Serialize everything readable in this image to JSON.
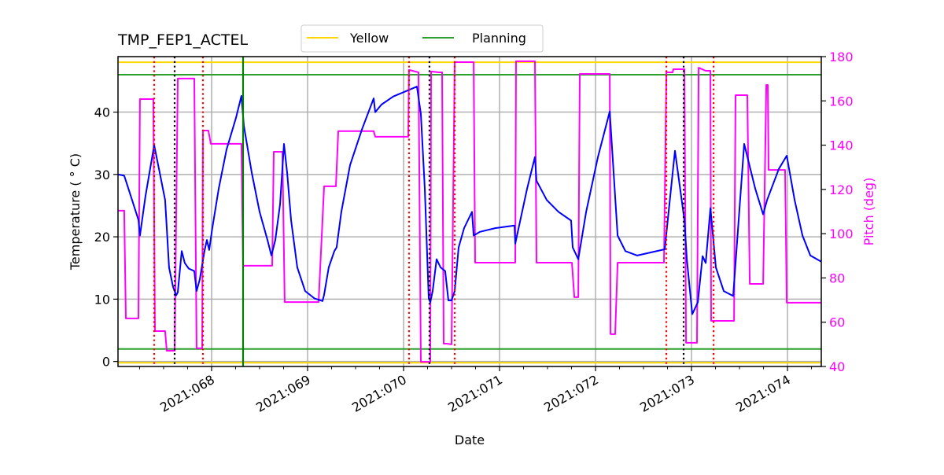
{
  "chart_data": {
    "type": "line",
    "title": "TMP_FEP1_ACTEL",
    "xlabel": "Date",
    "ylabel": "Temperature ($^\\circ$C)",
    "ylabel_display": "Temperature ( ° C)",
    "y2label": "Pitch (deg)",
    "xlim": [
      67.025,
      74.352
    ],
    "ylim": [
      -0.8,
      48.9
    ],
    "y2lim": [
      40,
      180
    ],
    "grid": true,
    "legend_position": "top-center",
    "x_ticks": [
      {
        "value": 68,
        "label": "2021:068"
      },
      {
        "value": 69,
        "label": "2021:069"
      },
      {
        "value": 70,
        "label": "2021:070"
      },
      {
        "value": 71,
        "label": "2021:071"
      },
      {
        "value": 72,
        "label": "2021:072"
      },
      {
        "value": 73,
        "label": "2021:073"
      },
      {
        "value": 74,
        "label": "2021:074"
      }
    ],
    "x_minor_step": 0.25,
    "y_ticks": [
      0,
      10,
      20,
      30,
      40
    ],
    "y2_ticks": [
      40,
      60,
      80,
      100,
      120,
      140,
      160,
      180
    ],
    "legend": [
      {
        "name": "Yellow",
        "color": "#ffd700"
      },
      {
        "name": "Planning",
        "color": "#2ca02c"
      }
    ],
    "limits": {
      "yellow": {
        "color": "#ffd700",
        "values": [
          48.0,
          -0.2
        ]
      },
      "planning": {
        "color": "#2ca02c",
        "values": [
          46.0,
          2.0
        ]
      }
    },
    "vlines": [
      {
        "x": 67.402,
        "color": "#ff0000",
        "style": "dotted"
      },
      {
        "x": 67.615,
        "color": "#000000",
        "style": "dotted"
      },
      {
        "x": 67.91,
        "color": "#ff0000",
        "style": "dotted"
      },
      {
        "x": 68.328,
        "color": "#008000",
        "style": "solid"
      },
      {
        "x": 70.057,
        "color": "#ff0000",
        "style": "dotted"
      },
      {
        "x": 70.27,
        "color": "#000000",
        "style": "dotted"
      },
      {
        "x": 70.533,
        "color": "#ff0000",
        "style": "dotted"
      },
      {
        "x": 72.738,
        "color": "#ff0000",
        "style": "dotted"
      },
      {
        "x": 72.918,
        "color": "#000000",
        "style": "dotted"
      },
      {
        "x": 73.23,
        "color": "#ff0000",
        "style": "dotted"
      }
    ],
    "series": [
      {
        "name": "TMP_FEP1_ACTEL",
        "axis": "left",
        "color": "#0000ff",
        "x": [
          67.025,
          67.09,
          67.107,
          67.172,
          67.238,
          67.254,
          67.311,
          67.402,
          67.459,
          67.516,
          67.533,
          67.557,
          67.598,
          67.631,
          67.648,
          67.689,
          67.721,
          67.762,
          67.82,
          67.844,
          67.877,
          67.926,
          67.951,
          67.975,
          68.008,
          68.074,
          68.156,
          68.254,
          68.311,
          68.336,
          68.418,
          68.5,
          68.582,
          68.623,
          68.664,
          68.713,
          68.754,
          68.787,
          68.828,
          68.893,
          68.975,
          69.074,
          69.156,
          69.172,
          69.221,
          69.279,
          69.303,
          69.352,
          69.443,
          69.566,
          69.689,
          69.705,
          69.77,
          69.893,
          70.016,
          70.139,
          70.18,
          70.221,
          70.262,
          70.279,
          70.303,
          70.344,
          70.385,
          70.434,
          70.467,
          70.5,
          70.533,
          70.574,
          70.631,
          70.713,
          70.73,
          70.795,
          70.959,
          71.156,
          71.164,
          71.287,
          71.369,
          71.385,
          71.492,
          71.615,
          71.746,
          71.762,
          71.82,
          71.902,
          72.025,
          72.148,
          72.23,
          72.311,
          72.434,
          72.721,
          72.828,
          72.926,
          72.951,
          73.008,
          73.066,
          73.115,
          73.148,
          73.197,
          73.254,
          73.336,
          73.434,
          73.549,
          73.664,
          73.746,
          73.787,
          73.91,
          73.992,
          74.074,
          74.156,
          74.238,
          74.352
        ],
        "y": [
          30.0,
          29.8,
          29.0,
          25.9,
          22.7,
          20.2,
          26.5,
          34.7,
          30.3,
          25.9,
          21.4,
          15.1,
          12.0,
          10.6,
          11.1,
          17.7,
          15.8,
          14.9,
          14.5,
          11.3,
          13.2,
          17.7,
          19.5,
          17.9,
          21.4,
          27.7,
          34.0,
          39.1,
          42.6,
          37.8,
          30.3,
          24.0,
          19.5,
          17.0,
          19.5,
          25.2,
          34.9,
          30.3,
          22.7,
          15.1,
          11.3,
          10.1,
          9.7,
          10.7,
          15.1,
          17.7,
          18.3,
          24.0,
          31.5,
          37.2,
          42.2,
          40.0,
          41.2,
          42.5,
          43.3,
          44.1,
          39.7,
          27.7,
          10.1,
          9.5,
          11.3,
          16.4,
          15.1,
          14.5,
          9.8,
          9.8,
          11.3,
          18.3,
          21.4,
          24.0,
          20.2,
          20.8,
          21.4,
          21.8,
          18.9,
          27.7,
          32.8,
          29.0,
          25.9,
          24.0,
          22.6,
          18.3,
          16.4,
          24.0,
          32.8,
          40.1,
          20.2,
          17.7,
          17.0,
          18.0,
          33.8,
          22.7,
          16.4,
          7.6,
          9.5,
          16.9,
          15.8,
          24.6,
          15.1,
          11.3,
          10.5,
          34.9,
          27.7,
          23.6,
          25.9,
          30.9,
          33.0,
          25.9,
          20.2,
          17.0,
          16.0
        ]
      },
      {
        "name": "Pitch",
        "axis": "right",
        "color": "#ff00ff",
        "x": [
          67.025,
          67.09,
          67.107,
          67.238,
          67.254,
          67.393,
          67.41,
          67.516,
          67.533,
          67.615,
          67.648,
          67.82,
          67.844,
          67.902,
          67.91,
          67.967,
          67.992,
          68.311,
          68.328,
          68.631,
          68.648,
          68.738,
          68.762,
          69.115,
          69.172,
          69.295,
          69.32,
          69.689,
          69.705,
          70.049,
          70.057,
          70.156,
          70.18,
          70.279,
          70.287,
          70.369,
          70.402,
          70.418,
          70.451,
          70.5,
          70.533,
          70.73,
          70.746,
          71.164,
          71.172,
          71.369,
          71.385,
          71.754,
          71.779,
          71.82,
          71.836,
          72.148,
          72.156,
          72.205,
          72.23,
          72.713,
          72.738,
          72.803,
          72.811,
          72.926,
          72.943,
          73.057,
          73.074,
          73.148,
          73.197,
          73.205,
          73.443,
          73.459,
          73.582,
          73.607,
          73.746,
          73.779,
          73.795,
          73.803,
          73.975,
          73.992,
          74.352
        ],
        "y": [
          110.4,
          110.4,
          61.7,
          61.7,
          160.8,
          160.8,
          56.0,
          56.0,
          47.1,
          47.1,
          170.1,
          170.1,
          48.2,
          48.2,
          146.6,
          146.6,
          140.6,
          140.6,
          85.5,
          85.5,
          137.0,
          137.0,
          69.1,
          69.1,
          121.4,
          121.4,
          146.3,
          146.3,
          143.8,
          143.8,
          174.0,
          172.9,
          42.1,
          42.1,
          173.3,
          172.9,
          172.9,
          50.3,
          50.3,
          50.0,
          177.5,
          177.5,
          86.9,
          86.9,
          177.9,
          177.9,
          86.9,
          86.9,
          71.3,
          71.3,
          172.2,
          172.2,
          54.6,
          54.6,
          86.9,
          86.9,
          172.9,
          172.9,
          174.3,
          174.3,
          50.7,
          50.7,
          175.0,
          173.6,
          173.6,
          60.6,
          60.6,
          162.6,
          162.6,
          77.3,
          77.3,
          167.2,
          167.2,
          128.8,
          128.8,
          68.8,
          68.8
        ]
      }
    ]
  }
}
